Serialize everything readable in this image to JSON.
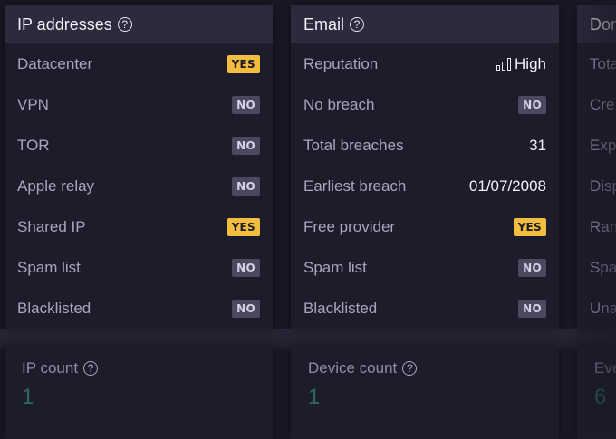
{
  "ip_card": {
    "title": "IP addresses",
    "help_icon": "?",
    "rows": [
      {
        "label": "Datacenter",
        "value": "YES",
        "kind": "yes"
      },
      {
        "label": "VPN",
        "value": "NO",
        "kind": "no"
      },
      {
        "label": "TOR",
        "value": "NO",
        "kind": "no"
      },
      {
        "label": "Apple relay",
        "value": "NO",
        "kind": "no"
      },
      {
        "label": "Shared IP",
        "value": "YES",
        "kind": "yes"
      },
      {
        "label": "Spam list",
        "value": "NO",
        "kind": "no"
      },
      {
        "label": "Blacklisted",
        "value": "NO",
        "kind": "no"
      }
    ]
  },
  "email_card": {
    "title": "Email",
    "help_icon": "?",
    "rows": [
      {
        "label": "Reputation",
        "value": "High",
        "kind": "text",
        "icon": "signal-bars-icon"
      },
      {
        "label": "No breach",
        "value": "NO",
        "kind": "no"
      },
      {
        "label": "Total breaches",
        "value": "31",
        "kind": "text"
      },
      {
        "label": "Earliest breach",
        "value": "01/07/2008",
        "kind": "text"
      },
      {
        "label": "Free provider",
        "value": "YES",
        "kind": "yes"
      },
      {
        "label": "Spam list",
        "value": "NO",
        "kind": "no"
      },
      {
        "label": "Blacklisted",
        "value": "NO",
        "kind": "no"
      }
    ]
  },
  "domain_card": {
    "title": "Dom",
    "rows": [
      "Tota",
      "Cre",
      "Exp",
      "Disp",
      "Ran",
      "Spa",
      "Una"
    ]
  },
  "stats": [
    {
      "label": "IP count",
      "value": "1"
    },
    {
      "label": "Device count",
      "value": "1"
    },
    {
      "label": "Eve",
      "value": "6"
    }
  ],
  "colors": {
    "yes_badge": "#f3bd3f",
    "no_badge": "#4a4960",
    "stat_value": "#2b6b5f"
  }
}
